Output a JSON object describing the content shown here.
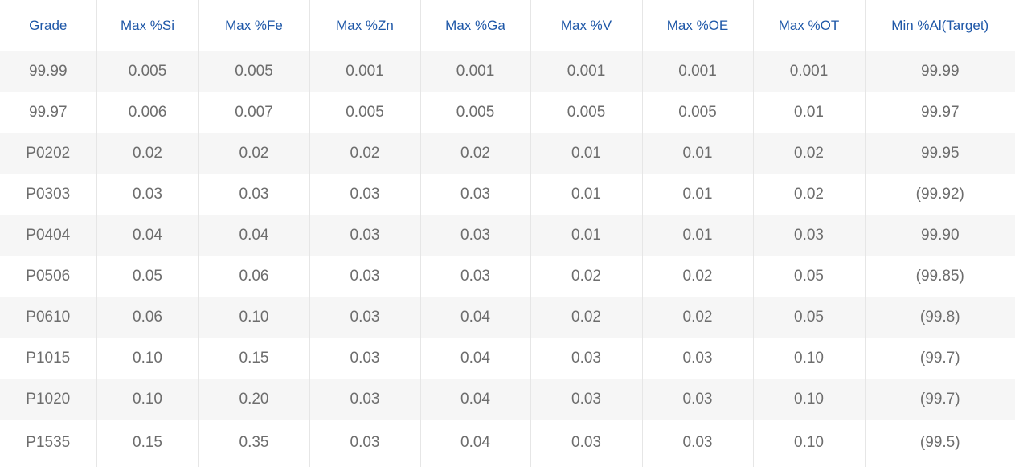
{
  "table": {
    "headers": [
      "Grade",
      "Max %Si",
      "Max %Fe",
      "Max %Zn",
      "Max %Ga",
      "Max %V",
      "Max %OE",
      "Max %OT",
      "Min %Al(Target)"
    ],
    "rows": [
      [
        "99.99",
        "0.005",
        "0.005",
        "0.001",
        "0.001",
        "0.001",
        "0.001",
        "0.001",
        "99.99"
      ],
      [
        "99.97",
        "0.006",
        "0.007",
        "0.005",
        "0.005",
        "0.005",
        "0.005",
        "0.01",
        "99.97"
      ],
      [
        "P0202",
        "0.02",
        "0.02",
        "0.02",
        "0.02",
        "0.01",
        "0.01",
        "0.02",
        "99.95"
      ],
      [
        "P0303",
        "0.03",
        "0.03",
        "0.03",
        "0.03",
        "0.01",
        "0.01",
        "0.02",
        "(99.92)"
      ],
      [
        "P0404",
        "0.04",
        "0.04",
        "0.03",
        "0.03",
        "0.01",
        "0.01",
        "0.03",
        "99.90"
      ],
      [
        "P0506",
        "0.05",
        "0.06",
        "0.03",
        "0.03",
        "0.02",
        "0.02",
        "0.05",
        "(99.85)"
      ],
      [
        "P0610",
        "0.06",
        "0.10",
        "0.03",
        "0.04",
        "0.02",
        "0.02",
        "0.05",
        "(99.8)"
      ],
      [
        "P1015",
        "0.10",
        "0.15",
        "0.03",
        "0.04",
        "0.03",
        "0.03",
        "0.10",
        "(99.7)"
      ],
      [
        "P1020",
        "0.10",
        "0.20",
        "0.03",
        "0.04",
        "0.03",
        "0.03",
        "0.10",
        "(99.7)"
      ],
      [
        "P1535",
        "0.15",
        "0.35",
        "0.03",
        "0.04",
        "0.03",
        "0.03",
        "0.10",
        "(99.5)"
      ]
    ]
  },
  "colors": {
    "header_text": "#1f58a8",
    "cell_text": "#6d6d6d",
    "stripe": "#f6f6f6",
    "divider": "#e6e6e6"
  }
}
